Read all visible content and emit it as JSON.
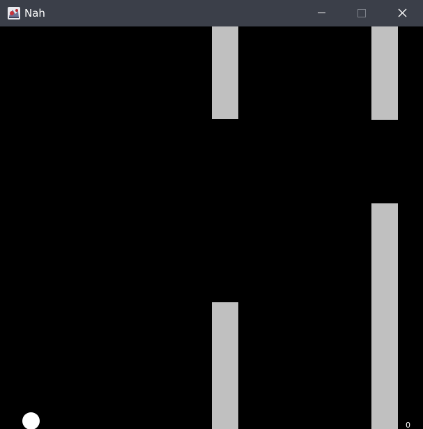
{
  "window": {
    "title": "Nah",
    "app_icon": "java-app-icon",
    "controls": [
      "minimize-icon",
      "maximize-icon",
      "close-icon"
    ],
    "titlebar_color": "#3b3f49"
  },
  "game": {
    "background_color": "#000000",
    "pipe_color": "#c0c0c0",
    "player_color": "#ffffff",
    "score": "0"
  }
}
